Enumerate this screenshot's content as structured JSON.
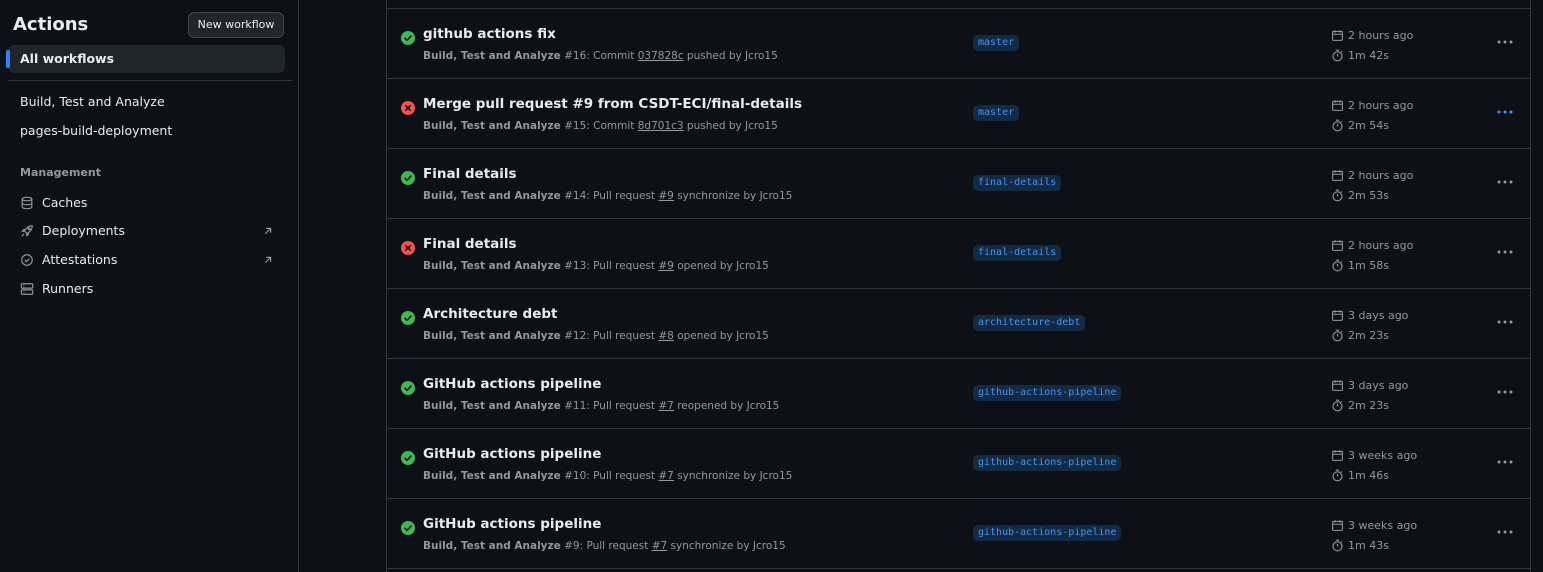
{
  "sidebar": {
    "title": "Actions",
    "new_workflow_label": "New workflow",
    "all_workflows_label": "All workflows",
    "workflows": [
      "Build, Test and Analyze",
      "pages-build-deployment"
    ],
    "management_label": "Management",
    "management_items": [
      {
        "label": "Caches",
        "icon": "database-icon",
        "external": false
      },
      {
        "label": "Deployments",
        "icon": "rocket-icon",
        "external": true
      },
      {
        "label": "Attestations",
        "icon": "verified-icon",
        "external": true
      },
      {
        "label": "Runners",
        "icon": "server-icon",
        "external": false
      }
    ]
  },
  "colors": {
    "success": "#3fb950",
    "failure": "#f85149",
    "accent": "#2f81f7",
    "branch_bg": "#122a43",
    "branch_fg": "#4493f8"
  },
  "runs": [
    {
      "status": "success",
      "title": "github actions fix",
      "workflow": "Build, Test and Analyze",
      "run_number": "#16",
      "event_prefix": ": Commit ",
      "ref": "037828c",
      "event_suffix": " pushed by Jcro15",
      "branch": "master",
      "when": "2 hours ago",
      "duration": "1m 42s",
      "menu_highlight": false
    },
    {
      "status": "failure",
      "title": "Merge pull request #9 from CSDT-ECI/final-details",
      "workflow": "Build, Test and Analyze",
      "run_number": "#15",
      "event_prefix": ": Commit ",
      "ref": "8d701c3",
      "event_suffix": " pushed by Jcro15",
      "branch": "master",
      "when": "2 hours ago",
      "duration": "2m 54s",
      "menu_highlight": true
    },
    {
      "status": "success",
      "title": "Final details",
      "workflow": "Build, Test and Analyze",
      "run_number": "#14",
      "event_prefix": ": Pull request ",
      "ref": "#9",
      "event_suffix": " synchronize by Jcro15",
      "branch": "final-details",
      "when": "2 hours ago",
      "duration": "2m 53s",
      "menu_highlight": false
    },
    {
      "status": "failure",
      "title": "Final details",
      "workflow": "Build, Test and Analyze",
      "run_number": "#13",
      "event_prefix": ": Pull request ",
      "ref": "#9",
      "event_suffix": " opened by Jcro15",
      "branch": "final-details",
      "when": "2 hours ago",
      "duration": "1m 58s",
      "menu_highlight": false
    },
    {
      "status": "success",
      "title": "Architecture debt",
      "workflow": "Build, Test and Analyze",
      "run_number": "#12",
      "event_prefix": ": Pull request ",
      "ref": "#8",
      "event_suffix": " opened by Jcro15",
      "branch": "architecture-debt",
      "when": "3 days ago",
      "duration": "2m 23s",
      "menu_highlight": false
    },
    {
      "status": "success",
      "title": "GitHub actions pipeline",
      "workflow": "Build, Test and Analyze",
      "run_number": "#11",
      "event_prefix": ": Pull request ",
      "ref": "#7",
      "event_suffix": " reopened by Jcro15",
      "branch": "github-actions-pipeline",
      "when": "3 days ago",
      "duration": "2m 23s",
      "menu_highlight": false
    },
    {
      "status": "success",
      "title": "GitHub actions pipeline",
      "workflow": "Build, Test and Analyze",
      "run_number": "#10",
      "event_prefix": ": Pull request ",
      "ref": "#7",
      "event_suffix": " synchronize by Jcro15",
      "branch": "github-actions-pipeline",
      "when": "3 weeks ago",
      "duration": "1m 46s",
      "menu_highlight": false
    },
    {
      "status": "success",
      "title": "GitHub actions pipeline",
      "workflow": "Build, Test and Analyze",
      "run_number": "#9",
      "event_prefix": ": Pull request ",
      "ref": "#7",
      "event_suffix": " synchronize by Jcro15",
      "branch": "github-actions-pipeline",
      "when": "3 weeks ago",
      "duration": "1m 43s",
      "menu_highlight": false
    }
  ]
}
